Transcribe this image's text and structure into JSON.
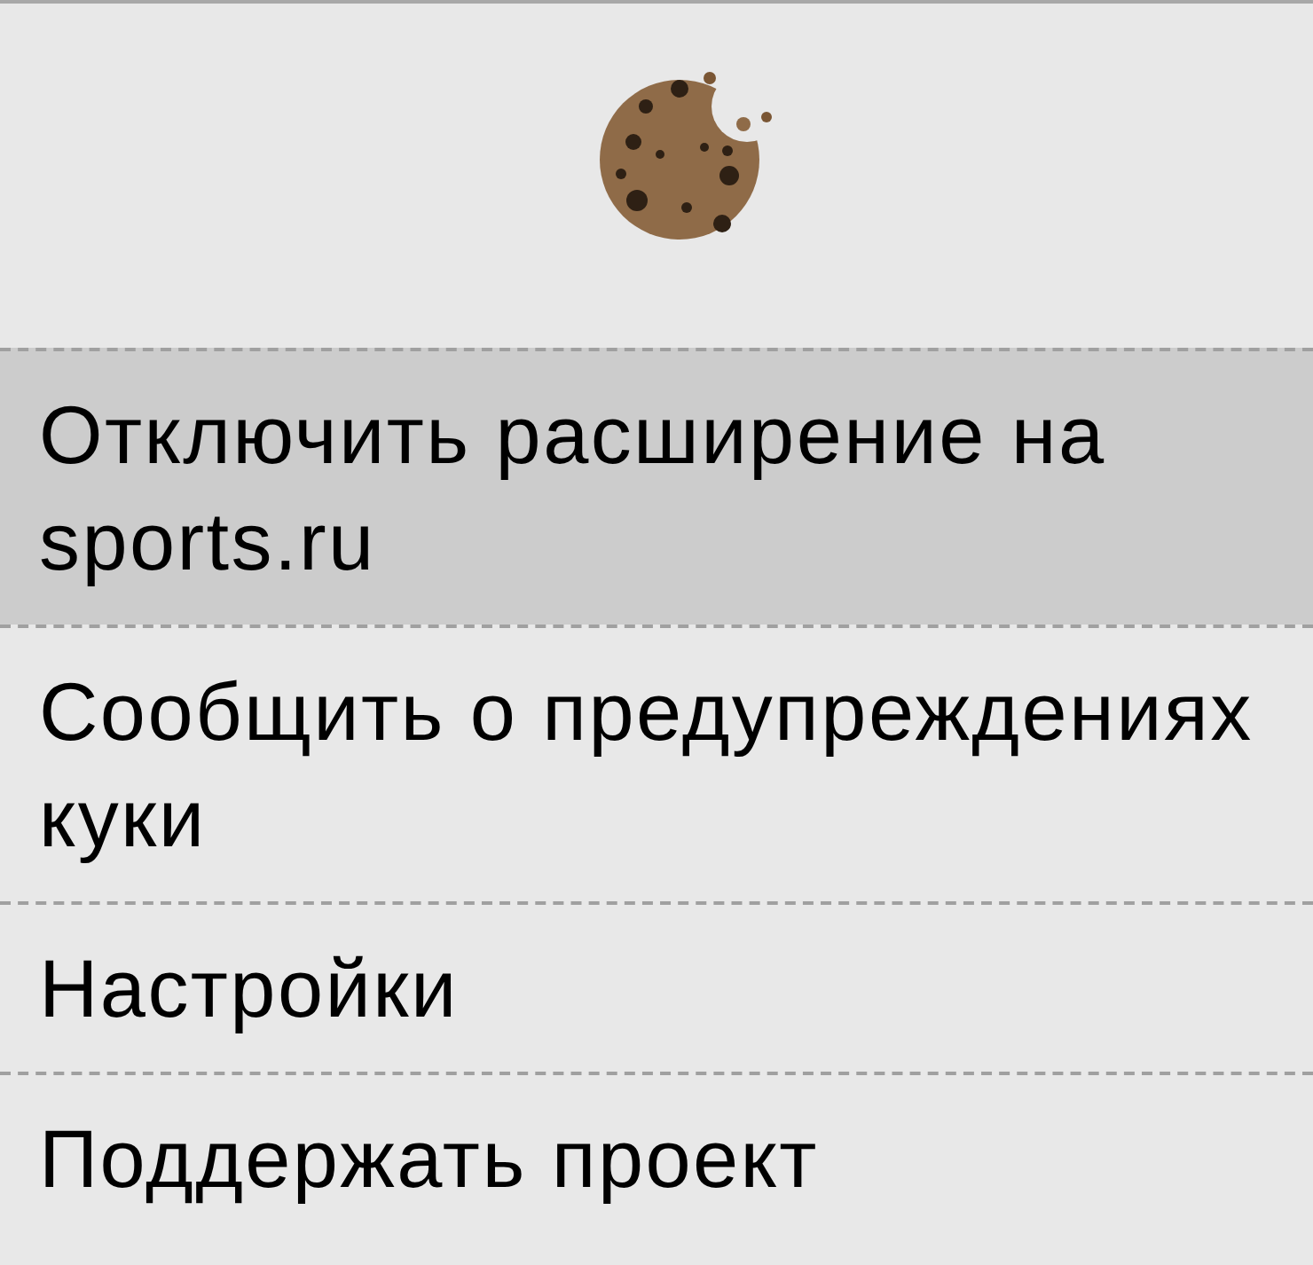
{
  "menu": {
    "items": [
      {
        "label": "Отключить расширение на sports.ru",
        "selected": true
      },
      {
        "label": "Сообщить о предупреждениях куки",
        "selected": false
      },
      {
        "label": "Настройки",
        "selected": false
      },
      {
        "label": "Поддержать проект",
        "selected": false
      }
    ]
  }
}
